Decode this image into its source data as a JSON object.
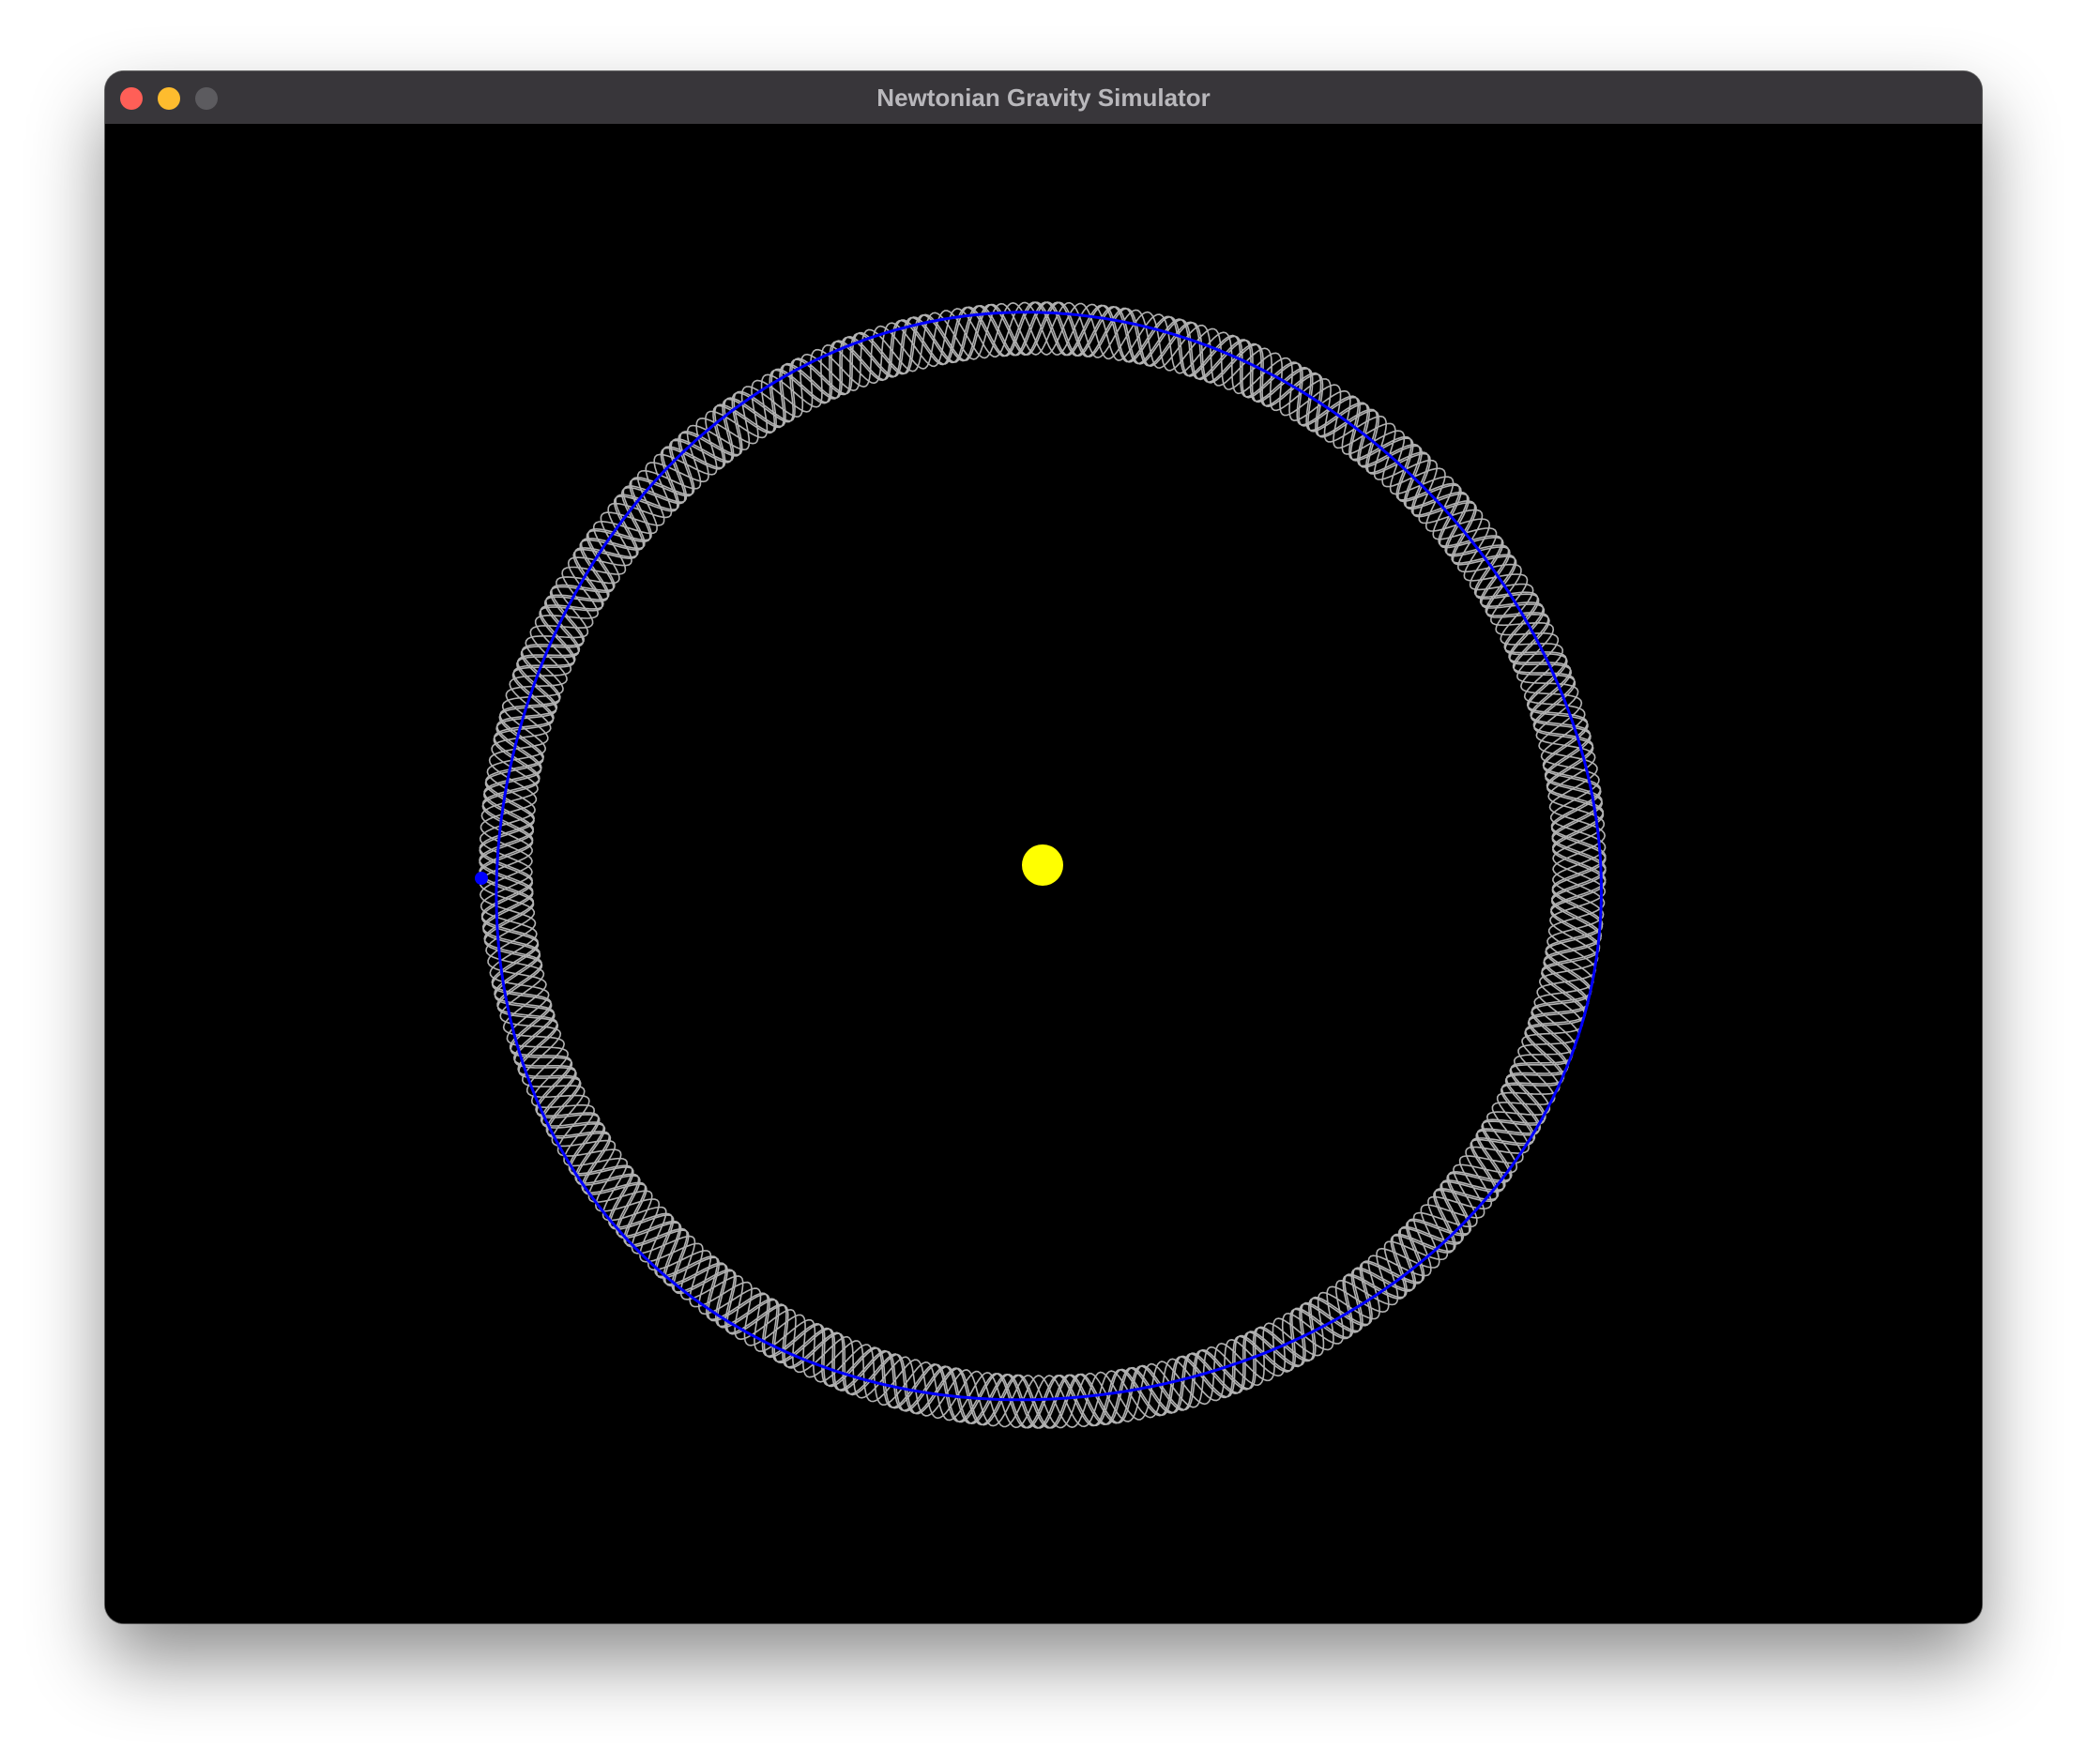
{
  "window": {
    "title": "Newtonian Gravity Simulator",
    "controls": [
      "close",
      "minimize",
      "zoom"
    ]
  },
  "scene": {
    "background_color": "#000000",
    "sun": {
      "color": "#ffff00"
    },
    "planet": {
      "color": "#0000ff"
    },
    "trail_color": "#d0d0d0",
    "current_orbit_color": "#0000ff",
    "orbit_shape": "precessing rosette"
  }
}
